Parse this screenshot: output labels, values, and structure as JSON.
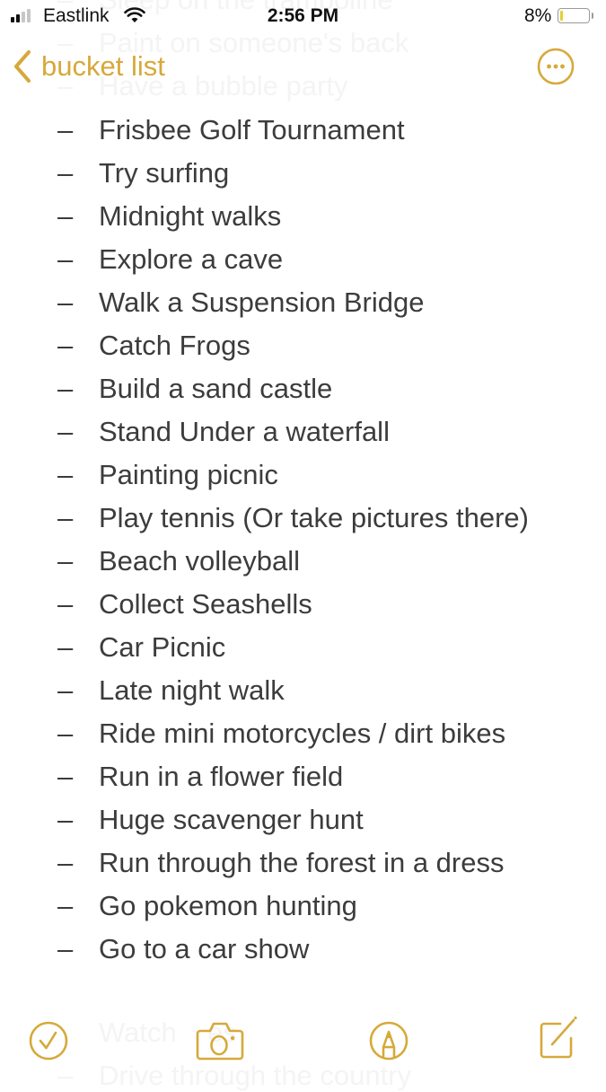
{
  "status_bar": {
    "carrier": "Eastlink",
    "time": "2:56 PM",
    "battery_percent": "8%",
    "battery_level": 0.08,
    "signal_bars": 2,
    "signal_bars_total": 4
  },
  "nav": {
    "back_label": "bucket list",
    "accent_color": "#d6a93a"
  },
  "ghost_above": [
    "Sleep on the trampoline",
    "Paint on someone's back",
    "Have a bubble party"
  ],
  "ghost_below": [
    "Watch    es",
    "Drive through the country"
  ],
  "list": {
    "bullet": "–",
    "items": [
      "Frisbee Golf Tournament",
      "Try surfing",
      "Midnight walks",
      "Explore a cave",
      "Walk a Suspension Bridge",
      "Catch Frogs",
      "Build a sand castle",
      "Stand Under a waterfall",
      "Painting picnic",
      "Play tennis (Or take pictures there)",
      "Beach volleyball",
      "Collect Seashells",
      "Car Picnic",
      "Late night walk",
      "Ride mini motorcycles / dirt bikes",
      "Run in a flower field",
      "Huge scavenger hunt",
      "Run through the forest in a dress",
      "Go pokemon hunting",
      "Go to a car show"
    ]
  },
  "toolbar": {
    "items": [
      "checklist-icon",
      "camera-icon",
      "markup-icon",
      "compose-icon"
    ]
  }
}
